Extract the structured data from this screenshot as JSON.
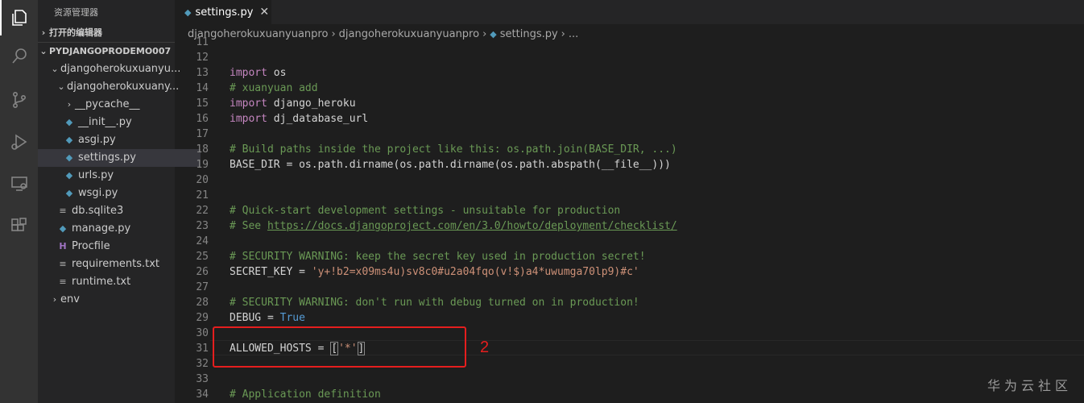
{
  "sidebar": {
    "title": "资源管理器",
    "open_editors": "打开的编辑器",
    "project": "PYDJANGOPRODEMO007",
    "tree": [
      {
        "label": "djangoherokuxuanyu...",
        "chevron": "⌄",
        "icon": ""
      },
      {
        "label": "djangoherokuxuany...",
        "chevron": "⌄",
        "icon": ""
      },
      {
        "label": "__pycache__",
        "chevron": "›",
        "icon": ""
      },
      {
        "label": "__init__.py",
        "chevron": "",
        "icon": "python-icon"
      },
      {
        "label": "asgi.py",
        "chevron": "",
        "icon": "python-icon"
      },
      {
        "label": "settings.py",
        "chevron": "",
        "icon": "python-icon"
      },
      {
        "label": "urls.py",
        "chevron": "",
        "icon": "python-icon"
      },
      {
        "label": "wsgi.py",
        "chevron": "",
        "icon": "python-icon"
      },
      {
        "label": "db.sqlite3",
        "chevron": "",
        "icon": "database-icon"
      },
      {
        "label": "manage.py",
        "chevron": "",
        "icon": "python-icon"
      },
      {
        "label": "Procfile",
        "chevron": "",
        "icon": "heroku-icon"
      },
      {
        "label": "requirements.txt",
        "chevron": "",
        "icon": "text-file-icon"
      },
      {
        "label": "runtime.txt",
        "chevron": "",
        "icon": "text-file-icon"
      },
      {
        "label": "env",
        "chevron": "›",
        "icon": ""
      }
    ]
  },
  "tab": {
    "label": "settings.py",
    "close": "✕"
  },
  "breadcrumb": {
    "items": [
      "djangoherokuxuanyuanpro",
      "djangoherokuxuanyuanpro",
      "settings.py",
      "..."
    ],
    "separator": "›"
  },
  "editor": {
    "lines": [
      {
        "num": "11"
      },
      {
        "num": "12"
      },
      {
        "num": "13",
        "kw": "import",
        "text": " os"
      },
      {
        "num": "14",
        "comment": "# xuanyuan add"
      },
      {
        "num": "15",
        "kw": "import",
        "text": " django_heroku"
      },
      {
        "num": "16",
        "kw": "import",
        "text": " dj_database_url"
      },
      {
        "num": "17"
      },
      {
        "num": "18",
        "comment": "# Build paths inside the project like this: os.path.join(BASE_DIR, ...)"
      },
      {
        "num": "19",
        "text": "BASE_DIR = os.path.dirname(os.path.dirname(os.path.abspath(__file__)))"
      },
      {
        "num": "20"
      },
      {
        "num": "21"
      },
      {
        "num": "22",
        "comment": "# Quick-start development settings - unsuitable for production"
      },
      {
        "num": "23",
        "comment": "# See ",
        "url": "https://docs.djangoproject.com/en/3.0/howto/deployment/checklist/"
      },
      {
        "num": "24"
      },
      {
        "num": "25",
        "comment": "# SECURITY WARNING: keep the secret key used in production secret!"
      },
      {
        "num": "26",
        "text": "SECRET_KEY = ",
        "str": "'y+!b2=x09ms4u)sv8c0#u2a04fqo(v!$)a4*uwumga70lp9)#c'"
      },
      {
        "num": "27"
      },
      {
        "num": "28",
        "comment": "# SECURITY WARNING: don't run with debug turned on in production!"
      },
      {
        "num": "29",
        "text": "DEBUG = ",
        "const": "True"
      },
      {
        "num": "30"
      },
      {
        "num": "31",
        "text": "ALLOWED_HOSTS = ",
        "bracket_open": "[",
        "str": "'*'",
        "bracket_close": "]"
      },
      {
        "num": "32"
      },
      {
        "num": "33"
      },
      {
        "num": "34",
        "comment": "# Application definition"
      }
    ]
  },
  "annotation": {
    "number": "2",
    "color": "#e51e1e"
  },
  "watermark": "华为云社区",
  "colors": {
    "keyword": "#c586c0",
    "comment": "#6a9955",
    "string": "#ce9178",
    "constant": "#569cd6",
    "background": "#1e1e1e"
  }
}
